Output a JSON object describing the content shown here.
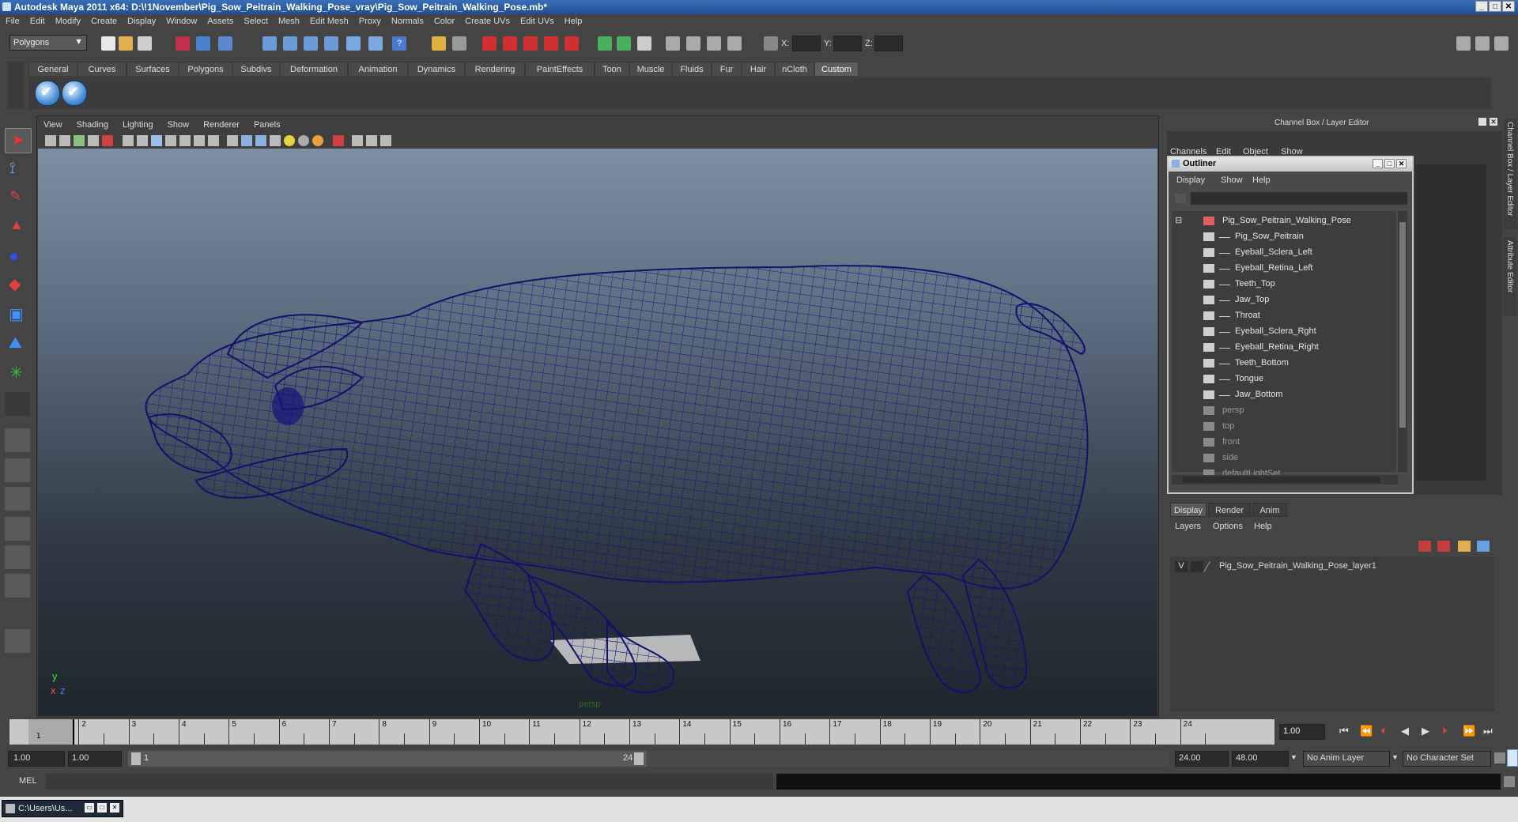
{
  "title": "Autodesk Maya 2011 x64: D:\\!1November\\Pig_Sow_Peitrain_Walking_Pose_vray\\Pig_Sow_Peitrain_Walking_Pose.mb*",
  "window_buttons": [
    "_",
    "□",
    "✕"
  ],
  "menu": [
    "File",
    "Edit",
    "Modify",
    "Create",
    "Display",
    "Window",
    "Assets",
    "Select",
    "Mesh",
    "Edit Mesh",
    "Proxy",
    "Normals",
    "Color",
    "Create UVs",
    "Edit UVs",
    "Help"
  ],
  "status_line": {
    "mode": "Polygons",
    "x_label": "X:",
    "y_label": "Y:",
    "z_label": "Z:"
  },
  "shelf_tabs": [
    "General",
    "Curves",
    "Surfaces",
    "Polygons",
    "Subdivs",
    "Deformation",
    "Animation",
    "Dynamics",
    "Rendering",
    "PaintEffects",
    "Toon",
    "Muscle",
    "Fluids",
    "Fur",
    "Hair",
    "nCloth",
    "Custom"
  ],
  "shelf_active": "Custom",
  "viewport": {
    "menu": [
      "View",
      "Shading",
      "Lighting",
      "Show",
      "Renderer",
      "Panels"
    ],
    "camera_label": "persp",
    "axis_y": "y",
    "axis_x": "x",
    "axis_z": "z",
    "wire_color": "#1a1a7a"
  },
  "channel_box": {
    "title": "Channel Box / Layer Editor",
    "menu": [
      "Channels",
      "Edit",
      "Object",
      "Show"
    ],
    "side_tabs": [
      "Channel Box / Layer Editor",
      "Attribute Editor"
    ]
  },
  "outliner": {
    "title": "Outliner",
    "menu": [
      "Display",
      "Show",
      "Help"
    ],
    "items": [
      {
        "label": "Pig_Sow_Peitrain_Walking_Pose",
        "depth": 0,
        "dim": false
      },
      {
        "label": "Pig_Sow_Peitrain",
        "depth": 1,
        "dim": false
      },
      {
        "label": "Eyeball_Sclera_Left",
        "depth": 1,
        "dim": false
      },
      {
        "label": "Eyeball_Retina_Left",
        "depth": 1,
        "dim": false
      },
      {
        "label": "Teeth_Top",
        "depth": 1,
        "dim": false
      },
      {
        "label": "Jaw_Top",
        "depth": 1,
        "dim": false
      },
      {
        "label": "Throat",
        "depth": 1,
        "dim": false
      },
      {
        "label": "Eyeball_Sclera_Rght",
        "depth": 1,
        "dim": false
      },
      {
        "label": "Eyeball_Retina_Right",
        "depth": 1,
        "dim": false
      },
      {
        "label": "Teeth_Bottom",
        "depth": 1,
        "dim": false
      },
      {
        "label": "Tongue",
        "depth": 1,
        "dim": false
      },
      {
        "label": "Jaw_Bottom",
        "depth": 1,
        "dim": false
      },
      {
        "label": "persp",
        "depth": 0,
        "dim": true
      },
      {
        "label": "top",
        "depth": 0,
        "dim": true
      },
      {
        "label": "front",
        "depth": 0,
        "dim": true
      },
      {
        "label": "side",
        "depth": 0,
        "dim": true
      },
      {
        "label": "defaultLightSet",
        "depth": 0,
        "dim": true
      }
    ]
  },
  "layer_editor": {
    "tabs": [
      "Display",
      "Render",
      "Anim"
    ],
    "active_tab": "Display",
    "menu": [
      "Layers",
      "Options",
      "Help"
    ],
    "layers": [
      {
        "visible": "V",
        "name": "Pig_Sow_Peitrain_Walking_Pose_layer1"
      }
    ]
  },
  "timeline": {
    "ticks": [
      "1",
      "2",
      "3",
      "4",
      "5",
      "6",
      "7",
      "8",
      "9",
      "10",
      "11",
      "12",
      "13",
      "14",
      "15",
      "16",
      "17",
      "18",
      "19",
      "20",
      "21",
      "22",
      "23",
      "24"
    ],
    "current_frame": "1.00",
    "current_marker": "1"
  },
  "range": {
    "start": "1.00",
    "playback_start": "1.00",
    "slider_start": "1",
    "slider_end": "24",
    "playback_end": "24.00",
    "end": "48.00",
    "anim_layer": "No Anim Layer",
    "char_set": "No Character Set"
  },
  "command_line": {
    "label": "MEL"
  },
  "taskbar": {
    "item": "C:\\Users\\Us..."
  }
}
